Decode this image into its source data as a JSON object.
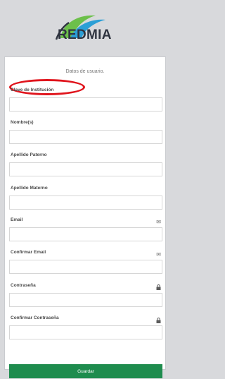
{
  "brand": {
    "name": "REDMIA",
    "mark": "."
  },
  "form": {
    "subtitle": "Datos de usuario.",
    "fields": {
      "clave": {
        "label": "Clave de Institución",
        "value": ""
      },
      "nombre": {
        "label": "Nombre(s)",
        "value": ""
      },
      "paterno": {
        "label": "Apellido Paterno",
        "value": ""
      },
      "materno": {
        "label": "Apellido Materno",
        "value": ""
      },
      "email": {
        "label": "Email",
        "value": "",
        "icon": "envelope-icon"
      },
      "confirm_email": {
        "label": "Confirmar Email",
        "value": "",
        "icon": "envelope-icon"
      },
      "password": {
        "label": "Contraseña",
        "value": "",
        "icon": "lock-icon"
      },
      "confirm_password": {
        "label": "Confirmar Contraseña",
        "value": "",
        "icon": "lock-icon"
      }
    },
    "submit_label": "Guardar"
  },
  "colors": {
    "accent": "#1e8c4e",
    "highlight": "#e0141c",
    "logo_green": "#6cc04a",
    "logo_blue": "#2b9fd6"
  }
}
